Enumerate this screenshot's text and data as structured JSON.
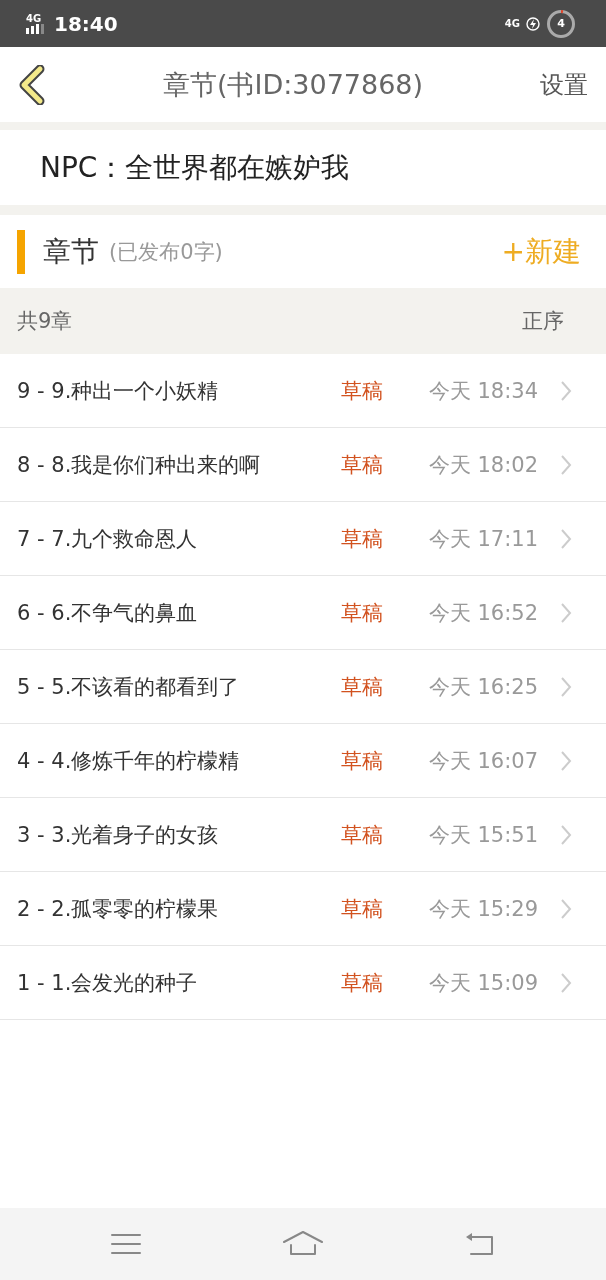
{
  "status_bar": {
    "signal_label": "4G",
    "time": "18:40",
    "network_label": "4G",
    "battery": "4"
  },
  "header": {
    "title": "章节(书ID:3077868)",
    "action": "设置"
  },
  "book": {
    "title": "NPC：全世界都在嫉妒我"
  },
  "section": {
    "title": "章节",
    "subtitle": "(已发布0字)",
    "new_button": "+新建"
  },
  "list_header": {
    "count": "共9章",
    "sort": "正序"
  },
  "chapters": [
    {
      "title": "9 - 9.种出一个小妖精",
      "status": "草稿",
      "time": "今天 18:34"
    },
    {
      "title": "8 - 8.我是你们种出来的啊",
      "status": "草稿",
      "time": "今天 18:02"
    },
    {
      "title": "7 - 7.九个救命恩人",
      "status": "草稿",
      "time": "今天 17:11"
    },
    {
      "title": "6 - 6.不争气的鼻血",
      "status": "草稿",
      "time": "今天 16:52"
    },
    {
      "title": "5 - 5.不该看的都看到了",
      "status": "草稿",
      "time": "今天 16:25"
    },
    {
      "title": "4 - 4.修炼千年的柠檬精",
      "status": "草稿",
      "time": "今天 16:07"
    },
    {
      "title": "3 - 3.光着身子的女孩",
      "status": "草稿",
      "time": "今天 15:51"
    },
    {
      "title": "2 - 2.孤零零的柠檬果",
      "status": "草稿",
      "time": "今天 15:29"
    },
    {
      "title": "1 - 1.会发光的种子",
      "status": "草稿",
      "time": "今天 15:09"
    }
  ]
}
